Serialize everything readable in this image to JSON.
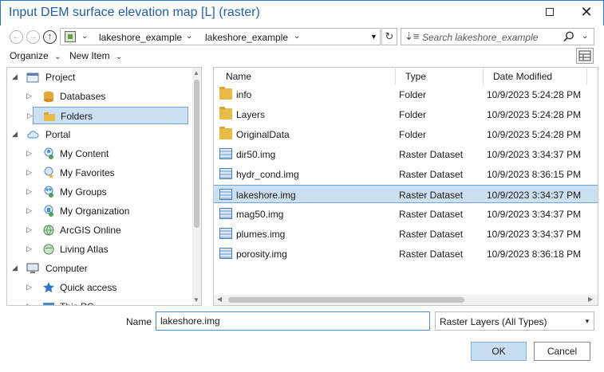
{
  "window": {
    "title": "Input DEM surface elevation map [L] (raster)",
    "maximize_icon": "maximize-icon",
    "close_glyph": "✕"
  },
  "nav": {
    "back_glyph": "←",
    "forward_glyph": "→",
    "up_glyph": "↑",
    "breadcrumbs": [
      "lakeshore_example",
      "lakeshore_example"
    ],
    "refresh_glyph": "↻"
  },
  "search": {
    "placeholder": "Search lakeshore_example",
    "sort_glyph": "⇣≡"
  },
  "toolbar": {
    "organize_label": "Organize",
    "new_item_label": "New Item"
  },
  "tree": {
    "items": [
      {
        "label": "Project",
        "icon": "project-icon",
        "level": 0,
        "expanded": true
      },
      {
        "label": "Databases",
        "icon": "database-icon",
        "level": 1
      },
      {
        "label": "Folders",
        "icon": "folder-icon",
        "level": 1,
        "selected": true
      },
      {
        "label": "Portal",
        "icon": "cloud-icon",
        "level": 0,
        "expanded": true
      },
      {
        "label": "My Content",
        "icon": "person-icon",
        "level": 1
      },
      {
        "label": "My Favorites",
        "icon": "star-icon",
        "level": 1
      },
      {
        "label": "My Groups",
        "icon": "group-icon",
        "level": 1
      },
      {
        "label": "My Organization",
        "icon": "building-icon",
        "level": 1
      },
      {
        "label": "ArcGIS Online",
        "icon": "globe-icon",
        "level": 1
      },
      {
        "label": "Living Atlas",
        "icon": "atlas-icon",
        "level": 1
      },
      {
        "label": "Computer",
        "icon": "computer-icon",
        "level": 0,
        "expanded": true
      },
      {
        "label": "Quick access",
        "icon": "star-blue-icon",
        "level": 1
      },
      {
        "label": "This PC",
        "icon": "pc-icon",
        "level": 1
      }
    ]
  },
  "list": {
    "columns": {
      "name": "Name",
      "type": "Type",
      "date": "Date Modified"
    },
    "rows": [
      {
        "name": "info",
        "type": "Folder",
        "date": "10/9/2023 5:24:28 PM",
        "kind": "folder"
      },
      {
        "name": "Layers",
        "type": "Folder",
        "date": "10/9/2023 5:24:28 PM",
        "kind": "folder"
      },
      {
        "name": "OriginalData",
        "type": "Folder",
        "date": "10/9/2023 5:24:28 PM",
        "kind": "folder"
      },
      {
        "name": "dir50.img",
        "type": "Raster Dataset",
        "date": "10/9/2023 3:34:37 PM",
        "kind": "raster"
      },
      {
        "name": "hydr_cond.img",
        "type": "Raster Dataset",
        "date": "10/9/2023 8:36:15 PM",
        "kind": "raster"
      },
      {
        "name": "lakeshore.img",
        "type": "Raster Dataset",
        "date": "10/9/2023 3:34:37 PM",
        "kind": "raster",
        "selected": true
      },
      {
        "name": "mag50.img",
        "type": "Raster Dataset",
        "date": "10/9/2023 3:34:37 PM",
        "kind": "raster"
      },
      {
        "name": "plumes.img",
        "type": "Raster Dataset",
        "date": "10/9/2023 3:34:37 PM",
        "kind": "raster"
      },
      {
        "name": "porosity.img",
        "type": "Raster Dataset",
        "date": "10/9/2023 8:36:18 PM",
        "kind": "raster"
      }
    ]
  },
  "footer": {
    "name_label": "Name",
    "name_value": "lakeshore.img",
    "filter_value": "Raster Layers (All Types)",
    "ok_label": "OK",
    "cancel_label": "Cancel"
  },
  "colors": {
    "accent": "#1f5ea8",
    "selection": "#cce0f4",
    "selection_border": "#6fa7d9",
    "folder": "#e8bb47"
  }
}
